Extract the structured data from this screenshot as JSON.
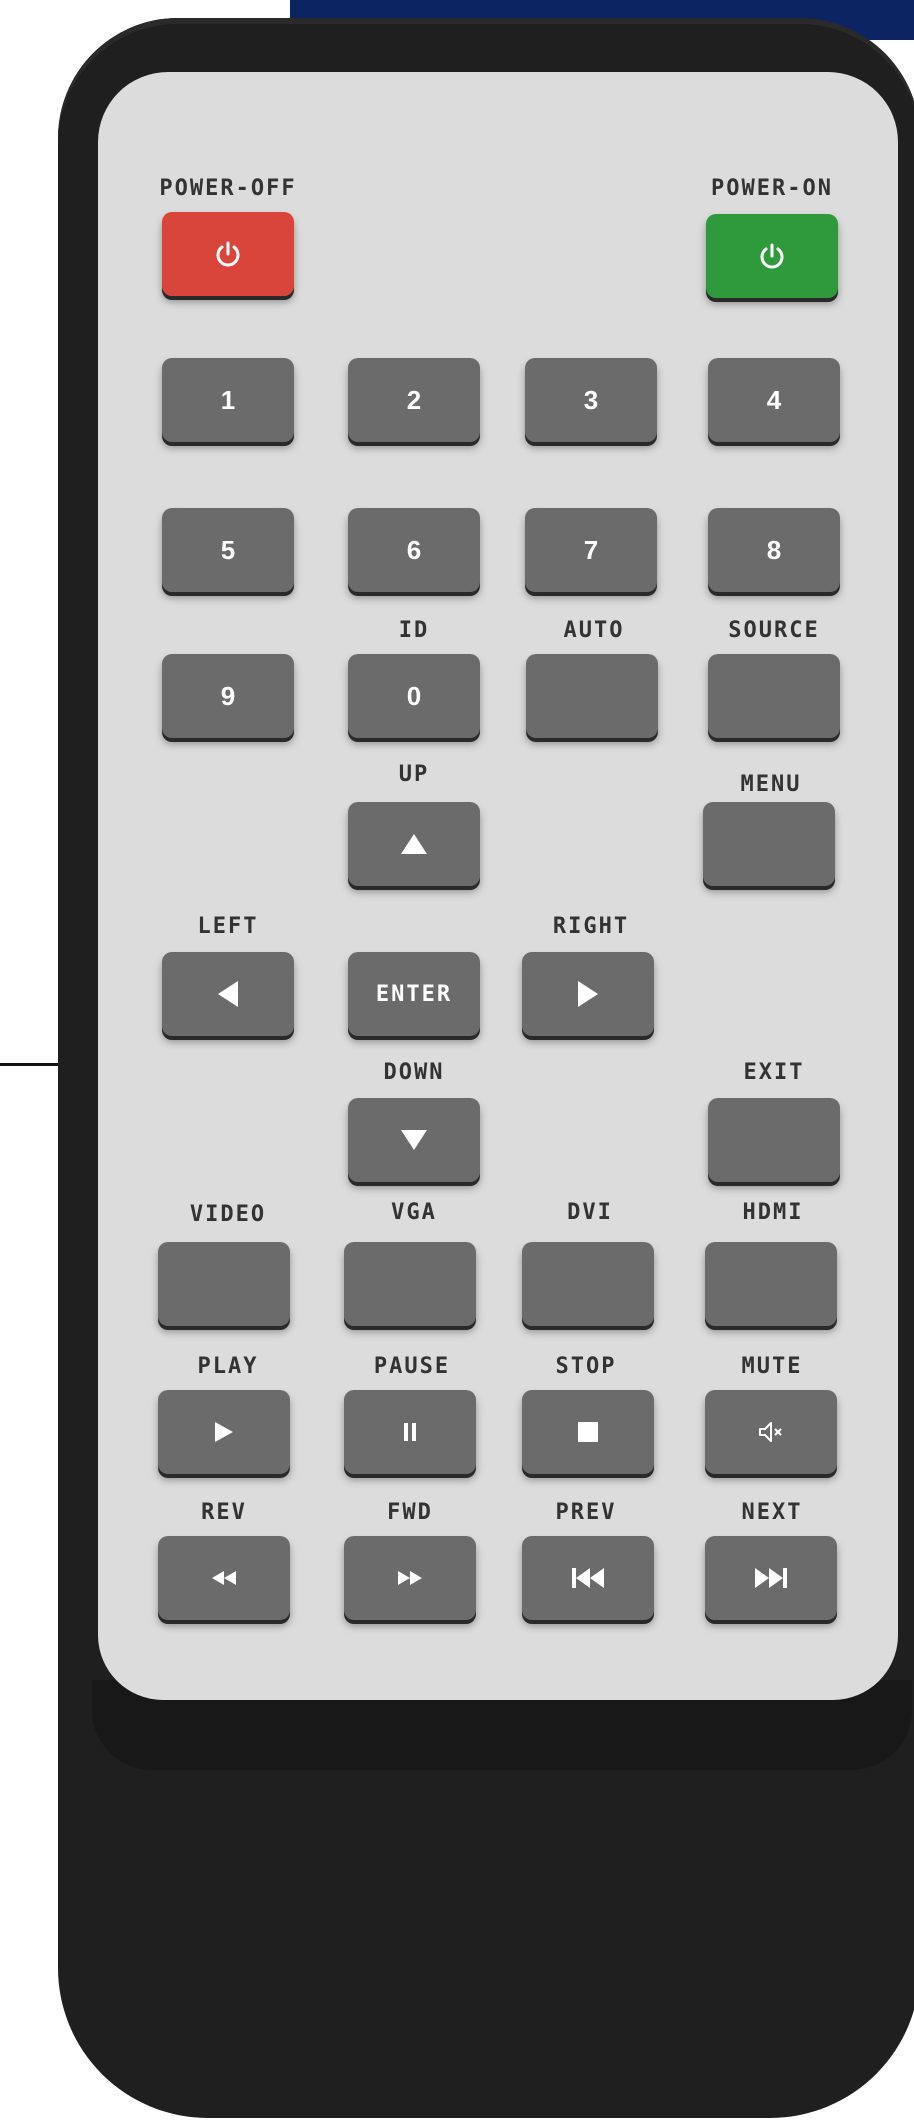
{
  "labels": {
    "power_off": "POWER-OFF",
    "power_on": "POWER-ON",
    "id": "ID",
    "auto": "AUTO",
    "source": "SOURCE",
    "up": "UP",
    "menu": "MENU",
    "left": "LEFT",
    "right": "RIGHT",
    "down": "DOWN",
    "exit": "EXIT",
    "video": "VIDEO",
    "vga": "VGA",
    "dvi": "DVI",
    "hdmi": "HDMI",
    "play": "PLAY",
    "pause": "PAUSE",
    "stop": "STOP",
    "mute": "MUTE",
    "rev": "REV",
    "fwd": "FWD",
    "prev": "PREV",
    "next": "NEXT"
  },
  "numbers": {
    "n1": "1",
    "n2": "2",
    "n3": "3",
    "n4": "4",
    "n5": "5",
    "n6": "6",
    "n7": "7",
    "n8": "8",
    "n9": "9",
    "n0": "0"
  },
  "enter_label": "ENTER",
  "colors": {
    "power_off": "#d9453b",
    "power_on": "#2e9a3c",
    "button": "#6b6b6b",
    "face": "#dcdcdc",
    "body": "#1f1f1f"
  },
  "icons": {
    "power": "power-icon",
    "up": "triangle-up-icon",
    "down": "triangle-down-icon",
    "left": "triangle-left-icon",
    "right": "triangle-right-icon",
    "play": "play-icon",
    "pause": "pause-icon",
    "stop": "stop-icon",
    "mute": "mute-icon",
    "rev": "rewind-icon",
    "fwd": "fast-forward-icon",
    "prev": "skip-previous-icon",
    "next": "skip-next-icon"
  }
}
